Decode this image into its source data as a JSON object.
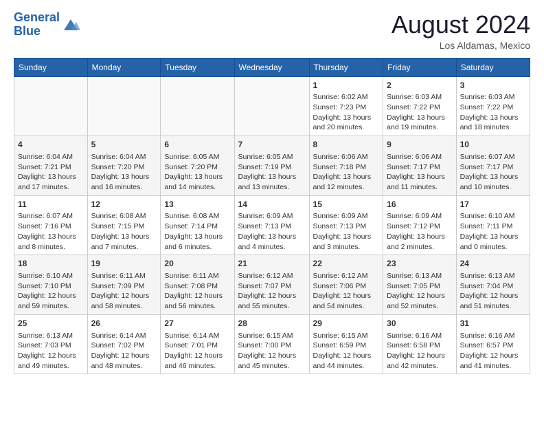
{
  "header": {
    "logo_line1": "General",
    "logo_line2": "Blue",
    "month_year": "August 2024",
    "location": "Los Aldamas, Mexico"
  },
  "weekdays": [
    "Sunday",
    "Monday",
    "Tuesday",
    "Wednesday",
    "Thursday",
    "Friday",
    "Saturday"
  ],
  "weeks": [
    [
      {
        "day": "",
        "info": ""
      },
      {
        "day": "",
        "info": ""
      },
      {
        "day": "",
        "info": ""
      },
      {
        "day": "",
        "info": ""
      },
      {
        "day": "1",
        "info": "Sunrise: 6:02 AM\nSunset: 7:23 PM\nDaylight: 13 hours\nand 20 minutes."
      },
      {
        "day": "2",
        "info": "Sunrise: 6:03 AM\nSunset: 7:22 PM\nDaylight: 13 hours\nand 19 minutes."
      },
      {
        "day": "3",
        "info": "Sunrise: 6:03 AM\nSunset: 7:22 PM\nDaylight: 13 hours\nand 18 minutes."
      }
    ],
    [
      {
        "day": "4",
        "info": "Sunrise: 6:04 AM\nSunset: 7:21 PM\nDaylight: 13 hours\nand 17 minutes."
      },
      {
        "day": "5",
        "info": "Sunrise: 6:04 AM\nSunset: 7:20 PM\nDaylight: 13 hours\nand 16 minutes."
      },
      {
        "day": "6",
        "info": "Sunrise: 6:05 AM\nSunset: 7:20 PM\nDaylight: 13 hours\nand 14 minutes."
      },
      {
        "day": "7",
        "info": "Sunrise: 6:05 AM\nSunset: 7:19 PM\nDaylight: 13 hours\nand 13 minutes."
      },
      {
        "day": "8",
        "info": "Sunrise: 6:06 AM\nSunset: 7:18 PM\nDaylight: 13 hours\nand 12 minutes."
      },
      {
        "day": "9",
        "info": "Sunrise: 6:06 AM\nSunset: 7:17 PM\nDaylight: 13 hours\nand 11 minutes."
      },
      {
        "day": "10",
        "info": "Sunrise: 6:07 AM\nSunset: 7:17 PM\nDaylight: 13 hours\nand 10 minutes."
      }
    ],
    [
      {
        "day": "11",
        "info": "Sunrise: 6:07 AM\nSunset: 7:16 PM\nDaylight: 13 hours\nand 8 minutes."
      },
      {
        "day": "12",
        "info": "Sunrise: 6:08 AM\nSunset: 7:15 PM\nDaylight: 13 hours\nand 7 minutes."
      },
      {
        "day": "13",
        "info": "Sunrise: 6:08 AM\nSunset: 7:14 PM\nDaylight: 13 hours\nand 6 minutes."
      },
      {
        "day": "14",
        "info": "Sunrise: 6:09 AM\nSunset: 7:13 PM\nDaylight: 13 hours\nand 4 minutes."
      },
      {
        "day": "15",
        "info": "Sunrise: 6:09 AM\nSunset: 7:13 PM\nDaylight: 13 hours\nand 3 minutes."
      },
      {
        "day": "16",
        "info": "Sunrise: 6:09 AM\nSunset: 7:12 PM\nDaylight: 13 hours\nand 2 minutes."
      },
      {
        "day": "17",
        "info": "Sunrise: 6:10 AM\nSunset: 7:11 PM\nDaylight: 13 hours\nand 0 minutes."
      }
    ],
    [
      {
        "day": "18",
        "info": "Sunrise: 6:10 AM\nSunset: 7:10 PM\nDaylight: 12 hours\nand 59 minutes."
      },
      {
        "day": "19",
        "info": "Sunrise: 6:11 AM\nSunset: 7:09 PM\nDaylight: 12 hours\nand 58 minutes."
      },
      {
        "day": "20",
        "info": "Sunrise: 6:11 AM\nSunset: 7:08 PM\nDaylight: 12 hours\nand 56 minutes."
      },
      {
        "day": "21",
        "info": "Sunrise: 6:12 AM\nSunset: 7:07 PM\nDaylight: 12 hours\nand 55 minutes."
      },
      {
        "day": "22",
        "info": "Sunrise: 6:12 AM\nSunset: 7:06 PM\nDaylight: 12 hours\nand 54 minutes."
      },
      {
        "day": "23",
        "info": "Sunrise: 6:13 AM\nSunset: 7:05 PM\nDaylight: 12 hours\nand 52 minutes."
      },
      {
        "day": "24",
        "info": "Sunrise: 6:13 AM\nSunset: 7:04 PM\nDaylight: 12 hours\nand 51 minutes."
      }
    ],
    [
      {
        "day": "25",
        "info": "Sunrise: 6:13 AM\nSunset: 7:03 PM\nDaylight: 12 hours\nand 49 minutes."
      },
      {
        "day": "26",
        "info": "Sunrise: 6:14 AM\nSunset: 7:02 PM\nDaylight: 12 hours\nand 48 minutes."
      },
      {
        "day": "27",
        "info": "Sunrise: 6:14 AM\nSunset: 7:01 PM\nDaylight: 12 hours\nand 46 minutes."
      },
      {
        "day": "28",
        "info": "Sunrise: 6:15 AM\nSunset: 7:00 PM\nDaylight: 12 hours\nand 45 minutes."
      },
      {
        "day": "29",
        "info": "Sunrise: 6:15 AM\nSunset: 6:59 PM\nDaylight: 12 hours\nand 44 minutes."
      },
      {
        "day": "30",
        "info": "Sunrise: 6:16 AM\nSunset: 6:58 PM\nDaylight: 12 hours\nand 42 minutes."
      },
      {
        "day": "31",
        "info": "Sunrise: 6:16 AM\nSunset: 6:57 PM\nDaylight: 12 hours\nand 41 minutes."
      }
    ]
  ]
}
